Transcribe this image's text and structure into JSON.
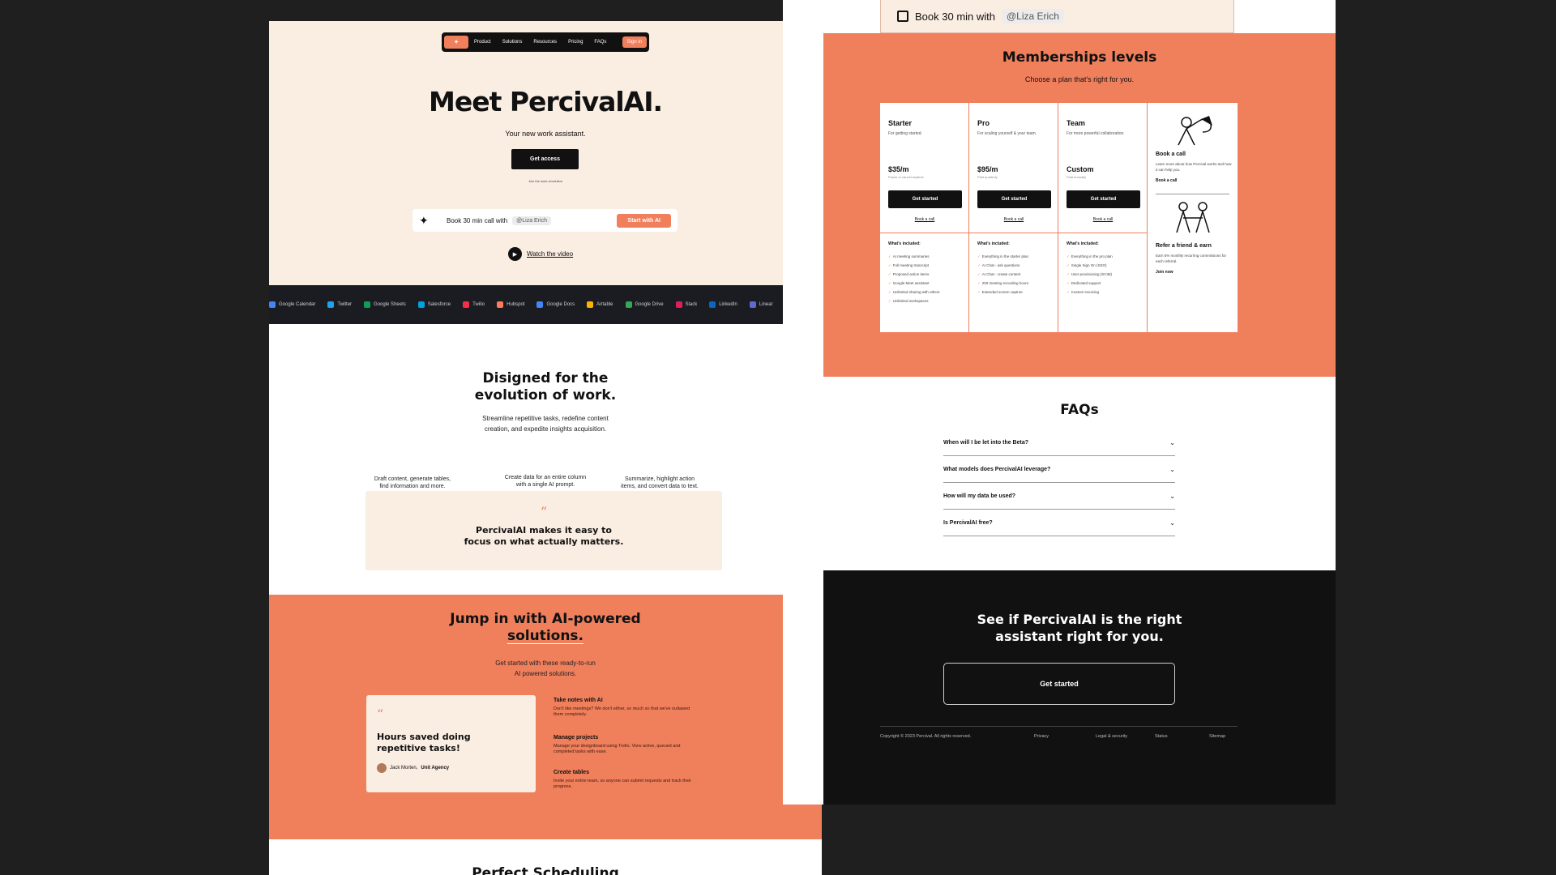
{
  "left": {
    "nav": {
      "logo": "✦",
      "items": [
        "Product",
        "Solutions",
        "Resources",
        "Pricing",
        "FAQs"
      ],
      "signin": "Sign in"
    },
    "hero": {
      "title": "Meet PercivalAI.",
      "subtitle": "Your new work assistant.",
      "button": "Get access",
      "small": "Join the work revolution",
      "book": {
        "text": "Book 30 min call with",
        "chip": "@Liza Erich",
        "cta": "Start with AI"
      },
      "watch": "Watch the video"
    },
    "logos": [
      {
        "name": "Google Calendar",
        "color": "#4285f4"
      },
      {
        "name": "Twitter",
        "color": "#1da1f2"
      },
      {
        "name": "Google Sheets",
        "color": "#0f9d58"
      },
      {
        "name": "Salesforce",
        "color": "#00a1e0"
      },
      {
        "name": "Twilio",
        "color": "#f22f46"
      },
      {
        "name": "Hubspot",
        "color": "#ff7a59"
      },
      {
        "name": "Google Docs",
        "color": "#4285f4"
      },
      {
        "name": "Airtable",
        "color": "#fcb400"
      },
      {
        "name": "Google Drive",
        "color": "#34a853"
      },
      {
        "name": "Slack",
        "color": "#e01e5a"
      },
      {
        "name": "LinkedIn",
        "color": "#0a66c2"
      },
      {
        "name": "Linear",
        "color": "#5e6ad2"
      }
    ],
    "designed": {
      "title_line1": "Disigned for the",
      "title_line2": "evolution of work.",
      "sub_line1": "Streamline repetitive tasks, redefine content",
      "sub_line2": "creation, and expedite insights acquisition.",
      "features": [
        {
          "l1": "Draft content, generate tables,",
          "l2": "find information and more."
        },
        {
          "l1": "Create data for an entire column",
          "l2": "with a single AI prompt."
        },
        {
          "l1": "Summarize, highlight action",
          "l2": "items, and convert data to text."
        }
      ],
      "quote_mark": "“",
      "quote_line1": "PercivalAI makes it easy to",
      "quote_line2": "focus on what actually matters."
    },
    "jump": {
      "title_line1": "Jump in with AI-powered",
      "title_line2": "solutions.",
      "sub_line1": "Get started with these ready-to-run",
      "sub_line2": "AI powered solutions.",
      "card": {
        "quote_mark": "“",
        "line1": "Hours saved doing",
        "line2": "repetitive tasks!",
        "author": "Jack Morten,",
        "company": "Unit Agency"
      },
      "solutions": [
        {
          "title": "Take notes with AI",
          "desc": "Don't like meetings? We don't either, so much so that we've outlawed them completely."
        },
        {
          "title": "Manage projects",
          "desc": "Manage your designboard using Trello. View active, queued and completed tasks with ease."
        },
        {
          "title": "Create tables",
          "desc": "Invite your entire team, so anyone can submit requests and track their progress."
        }
      ],
      "next_title": "Perfect Scheduling"
    }
  },
  "right": {
    "topbar": {
      "text": "Book 30 min with",
      "chip": "@Liza Erich"
    },
    "memberships": {
      "title": "Memberships levels",
      "subtitle": "Choose a plan that's right for you.",
      "plans": [
        {
          "name": "Starter",
          "desc": "For getting started.",
          "price": "$35/m",
          "billing": "Pause or cancel anytime",
          "button": "Get started",
          "call": "Book a call",
          "included": "What's included:",
          "features": [
            "AI meeting summaries",
            "Full meeting transcript",
            "Proposed action items",
            "Google Meet assistant",
            "Unlimited sharing with others",
            "Unlimited workspaces"
          ]
        },
        {
          "name": "Pro",
          "desc": "For scaling yourself & your team.",
          "price": "$95/m",
          "billing": "Paid quarterly",
          "button": "Get started",
          "call": "Book a call",
          "included": "What's included:",
          "features": [
            "Everything in the starter plan",
            "AI Chat - ask questions",
            "AI Chat - create content",
            "200 meeting recording hours",
            "Extended screen capture"
          ]
        },
        {
          "name": "Team",
          "desc": "For more powerful collaboration.",
          "price": "Custom",
          "billing": "Paid annually",
          "button": "Get started",
          "call": "Book a call",
          "included": "What's included:",
          "features": [
            "Everything in the pro plan",
            "Single Sign On (SSO)",
            "User provisioning (SCIM)",
            "Dedicated support",
            "Custom invoicing"
          ]
        }
      ],
      "side": {
        "call_title": "Book a call",
        "call_desc": "Learn more about how Percival works and how it can help you.",
        "call_link": "Book a call",
        "refer_title": "Refer a friend & earn",
        "refer_desc": "Earn 5% monthly recurring commissions for each referral.",
        "refer_link": "Join now"
      }
    },
    "faqs": {
      "title": "FAQs",
      "items": [
        "When will I be let into the Beta?",
        "What models does PercivalAI leverage?",
        "How will my data be used?",
        "Is PercivalAI free?"
      ]
    },
    "cta": {
      "title_line1": "See if PercivalAI is the right",
      "title_line2": "assistant right for you.",
      "button": "Get started",
      "copyright": "Copyright © 2023 Percival. All rights reserved.",
      "links": [
        "Privacy",
        "Legal & security",
        "Status",
        "Sitemap"
      ]
    }
  },
  "colors": {
    "accent": "#f07f5c",
    "cream": "#faede2",
    "dark": "#111111",
    "bg": "#1f1f1f"
  }
}
